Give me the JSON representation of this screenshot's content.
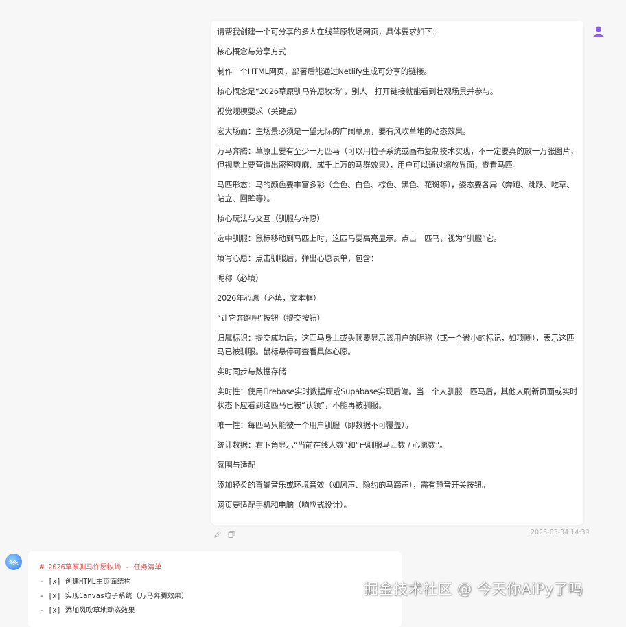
{
  "user_message": {
    "paragraphs": [
      "请帮我创建一个可分享的多人在线草原牧场网页，具体要求如下：",
      "核心概念与分享方式",
      "制作一个HTML网页，部署后能通过Netlify生成可分享的链接。",
      "核心概念是“2026草原驯马许愿牧场”，别人一打开链接就能看到壮观场景并参与。",
      "视觉规模要求（关键点）",
      "宏大场面：主场景必须是一望无际的广阔草原，要有风吹草地的动态效果。",
      "万马奔腾：草原上要有至少一万匹马（可以用粒子系统或画布复制技术实现，不一定要真的放一万张图片，但视觉上要营造出密密麻麻、成千上万的马群效果），用户可以通过缩放界面，查看马匹。",
      "马匹形态：马的颜色要丰富多彩（金色、白色、棕色、黑色、花斑等），姿态要各异（奔跑、跳跃、吃草、站立、回眸等）。",
      "核心玩法与交互（驯服与许愿）",
      "选中驯服：鼠标移动到马匹上时，这匹马要高亮显示。点击一匹马，视为“驯服”它。",
      "填写心愿：点击驯服后，弹出心愿表单，包含：",
      "昵称（必填）",
      "2026年心愿（必填，文本框）",
      "“让它奔跑吧”按钮（提交按钮）",
      "归属标识：提交成功后，这匹马身上或头顶要显示该用户的昵称（或一个微小的标记，如项圈），表示这匹马已被驯服。鼠标悬停可查看具体心愿。",
      "实时同步与数据存储",
      "实时性：使用Firebase实时数据库或Supabase实现后端。当一个人驯服一匹马后，其他人刷新页面或实时状态下应看到这匹马已被“认领”，不能再被驯服。",
      "唯一性：每匹马只能被一个用户驯服（即数据不可覆盖）。",
      "统计数据：右下角显示“当前在线人数”和“已驯服马匹数 / 心愿数”。",
      "氛围与适配",
      "添加轻柔的背景音乐或环境音效（如风声、隐约的马蹄声），需有静音开关按钮。",
      "网页要适配手机和电脑（响应式设计）。"
    ],
    "timestamp": "2026-03-04 14:39",
    "user_icon": "user-icon",
    "edit_icon": "edit-icon",
    "copy_icon": "copy-icon"
  },
  "assistant_message": {
    "lines": [
      "# 2026草原驯马许愿牧场 - 任务清单",
      "- [x] 创建HTML主页面结构",
      "- [x] 实现Canvas粒子系统（万马奔腾效果）",
      "- [x] 添加风吹草地动态效果"
    ],
    "assistant_icon": "assistant-logo-icon"
  },
  "watermark": "掘金技术社区 @ 今天你AiPy了吗"
}
